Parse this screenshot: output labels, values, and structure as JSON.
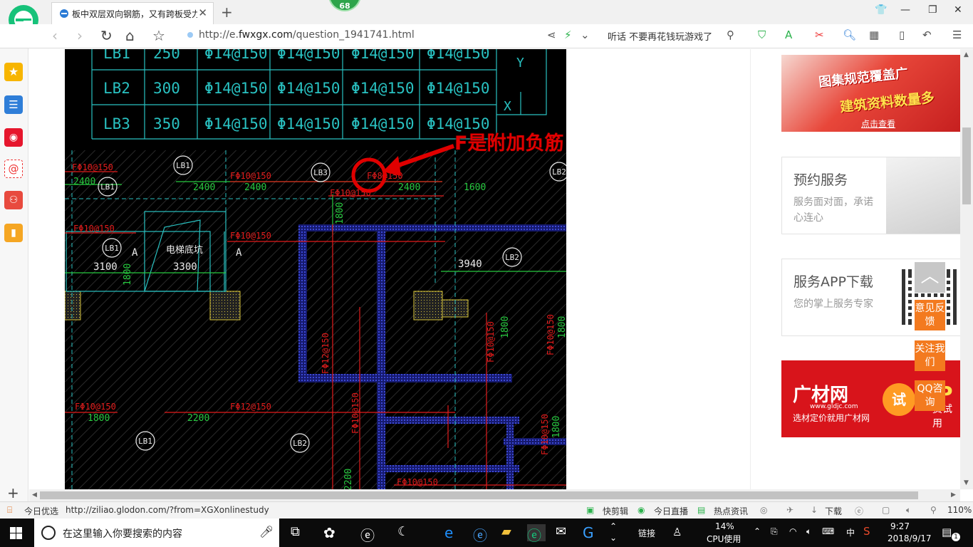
{
  "browser": {
    "tab_title": "板中双层双向钢筋，又有跨板受力筋",
    "tab_close": "✕",
    "new_tab": "+",
    "badge": "68",
    "url_prefix": "http://e.",
    "url_domain": "fwxgx.com",
    "url_path": "/question_1941741.html",
    "hot_search": "听话 不要再花钱玩游戏了",
    "search_icon": "search-icon"
  },
  "cad": {
    "table_rows": [
      {
        "name": "LB1",
        "thick": "250",
        "a": "Φ14@150",
        "b": "Φ14@150",
        "c": "Φ14@150",
        "d": "Φ14@150"
      },
      {
        "name": "LB2",
        "thick": "300",
        "a": "Φ14@150",
        "b": "Φ14@150",
        "c": "Φ14@150",
        "d": "Φ14@150"
      },
      {
        "name": "LB3",
        "thick": "350",
        "a": "Φ14@150",
        "b": "Φ14@150",
        "c": "Φ14@150",
        "d": "Φ14@150"
      }
    ],
    "axis_y": "Y",
    "axis_x": "X",
    "annotation": "F是附加负筋",
    "labels": {
      "rebar_f10": "FΦ10@150",
      "rebar_f12": "FΦ12@150",
      "rebar_f8": "FΦ8@150",
      "len_2400": "2400",
      "len_1600": "1600",
      "len_1800": "1800",
      "len_3100": "3100",
      "len_3300": "3300",
      "len_3940": "3940",
      "len_2200": "2200",
      "elevator": "电梯底坑",
      "mark_a": "A",
      "lb1": "LB1",
      "lb2": "LB2",
      "lb3": "LB3"
    }
  },
  "right": {
    "ad1_line1": "图集规范覆盖广",
    "ad1_line2": "建筑资料数量多",
    "ad1_line3": "点击查看",
    "svc1_title": "预约服务",
    "svc1_desc": "服务面对面，承诺心连心",
    "svc2_title": "服务APP下载",
    "svc2_desc": "您的掌上服务专家",
    "ad2_brand": "广材网",
    "ad2_site": "www.gldjc.com",
    "ad2_slogan": "选材定价就用广材网",
    "ad2_try": "试",
    "ad2_p": "P",
    "ad2_p2": "费试用"
  },
  "float": {
    "feedback": "意见反馈",
    "follow": "关注我们",
    "qq": "QQ咨询"
  },
  "statusbar": {
    "today": "今日优选",
    "link_url": "http://ziliao.glodon.com/?from=XGXonlinestudy",
    "clip": "快剪辑",
    "live": "今日直播",
    "news": "热点资讯",
    "download": "下载",
    "zoom": "110%"
  },
  "taskbar": {
    "search_placeholder": "在这里输入你要搜索的内容",
    "links": "链接",
    "cpu_pct": "14%",
    "cpu_label": "CPU使用",
    "ime": "中",
    "time": "9:27",
    "date": "2018/9/17",
    "notif": "1"
  }
}
